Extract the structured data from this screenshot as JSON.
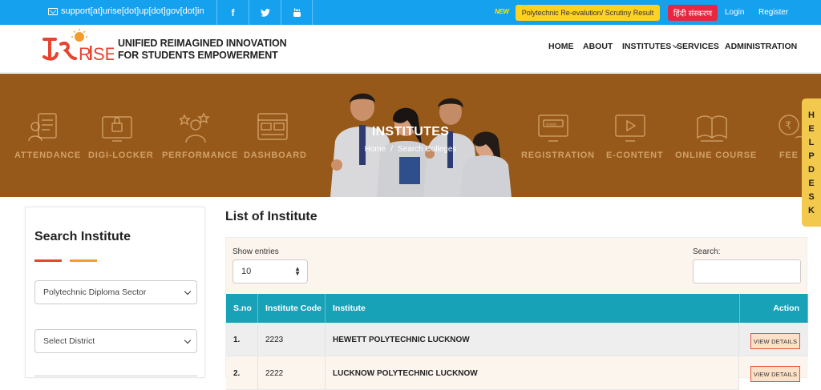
{
  "topbar": {
    "email": "support[at]urise[dot]up[dot]gov[dot]in",
    "social": [
      "f",
      "t",
      "yt"
    ],
    "new_badge": "NEW",
    "poly_button": "Polytechnic Re-evalution/ Scrutiny Result",
    "hindi_button": "हिंदी संस्करण",
    "login": "Login",
    "register": "Register"
  },
  "header": {
    "logo_text_line1": "UNIFIED REIMAGINED INNOVATION",
    "logo_text_line2": "FOR STUDENTS EMPOWERMENT",
    "nav": [
      "HOME",
      "ABOUT",
      "INSTITUTES",
      "SERVICES",
      "ADMINISTRATION"
    ]
  },
  "banner": {
    "title": "INSTITUTES",
    "breadcrumb_home": "Home",
    "breadcrumb_sep": "/",
    "breadcrumb_current": "Search Colleges",
    "icons_left": [
      "ATTENDANCE",
      "DIGI-LOCKER",
      "PERFORMANCE",
      "DASHBOARD"
    ],
    "icons_right": [
      "REGISTRATION",
      "E-CONTENT",
      "ONLINE COURSE",
      "FEE"
    ]
  },
  "helpdesk": [
    "H",
    "E",
    "L",
    "P",
    "D",
    "E",
    "S",
    "K"
  ],
  "sidebar": {
    "title": "Search Institute",
    "sector_select": "Polytechnic Diploma Sector",
    "district_select": "Select District"
  },
  "main": {
    "title": "List of Institute",
    "show_entries_label": "Show entries",
    "entries_value": "10",
    "search_label": "Search:",
    "columns": [
      "S.no",
      "Institute Code",
      "Institute",
      "Action"
    ],
    "rows": [
      {
        "sno": "1.",
        "code": "2223",
        "name": "HEWETT POLYTECHNIC LUCKNOW",
        "action": "VIEW DETAILS"
      },
      {
        "sno": "2.",
        "code": "2222",
        "name": "LUCKNOW POLYTECHNIC LUCKNOW",
        "action": "VIEW DETAILS"
      }
    ]
  },
  "colors": {
    "topbar": "#16a1ee",
    "banner": "#a8641e",
    "table_header": "#18a2b8",
    "accent_red": "#e8432f",
    "accent_orange": "#f39c2b"
  }
}
